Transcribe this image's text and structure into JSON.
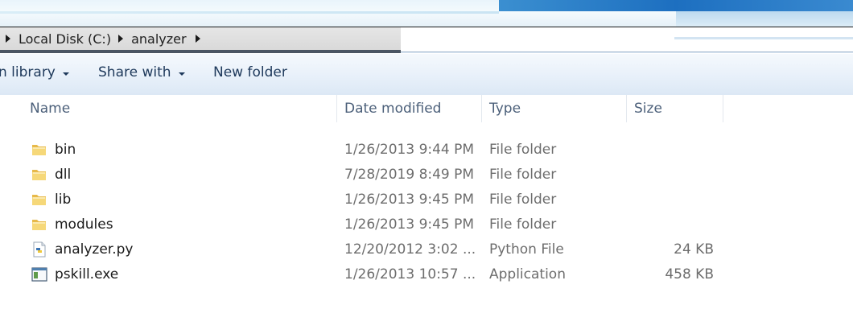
{
  "address": {
    "crumbs": [
      "Local Disk (C:)",
      "analyzer"
    ]
  },
  "toolbar": {
    "include_label": "n library",
    "share_label": "Share with",
    "new_folder_label": "New folder"
  },
  "columns": {
    "name": "Name",
    "date": "Date modified",
    "type": "Type",
    "size": "Size"
  },
  "files": [
    {
      "name": "bin",
      "date": "1/26/2013 9:44 PM",
      "type": "File folder",
      "size": "",
      "icon": "folder-icon"
    },
    {
      "name": "dll",
      "date": "7/28/2019 8:49 PM",
      "type": "File folder",
      "size": "",
      "icon": "folder-icon"
    },
    {
      "name": "lib",
      "date": "1/26/2013 9:45 PM",
      "type": "File folder",
      "size": "",
      "icon": "folder-icon"
    },
    {
      "name": "modules",
      "date": "1/26/2013 9:45 PM",
      "type": "File folder",
      "size": "",
      "icon": "folder-icon"
    },
    {
      "name": "analyzer.py",
      "date": "12/20/2012 3:02 ...",
      "type": "Python File",
      "size": "24 KB",
      "icon": "python-file-icon"
    },
    {
      "name": "pskill.exe",
      "date": "1/26/2013 10:57 ...",
      "type": "Application",
      "size": "458 KB",
      "icon": "application-icon"
    }
  ],
  "colors": {
    "toolbar_text": "#1e395b",
    "header_text": "#4c607a",
    "detail_text": "#6d6d6d",
    "folder_yellow": "#f4d472"
  }
}
